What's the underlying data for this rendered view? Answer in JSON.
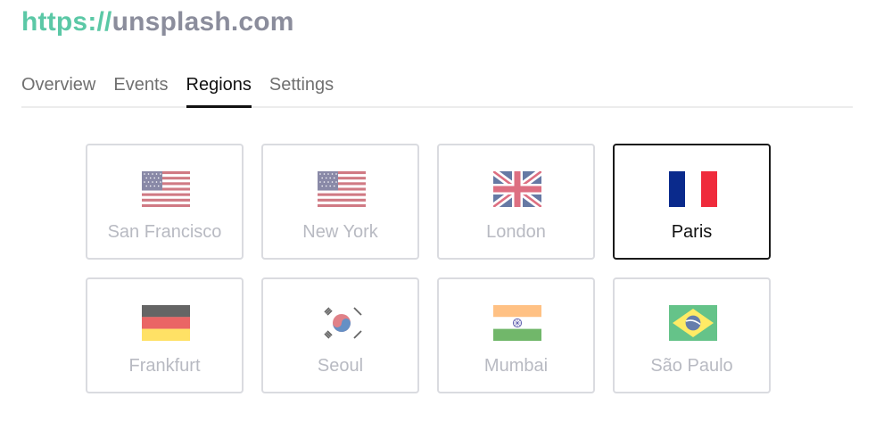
{
  "site": {
    "scheme": "https://",
    "host": "unsplash.com",
    "scheme_color": "#5bc8a6",
    "host_color": "#8b8d9c"
  },
  "tabs": [
    {
      "label": "Overview",
      "active": false
    },
    {
      "label": "Events",
      "active": false
    },
    {
      "label": "Regions",
      "active": true
    },
    {
      "label": "Settings",
      "active": false
    }
  ],
  "regions": [
    {
      "name": "San Francisco",
      "flag": "us-flag-icon",
      "selected": false
    },
    {
      "name": "New York",
      "flag": "us-flag-icon",
      "selected": false
    },
    {
      "name": "London",
      "flag": "uk-flag-icon",
      "selected": false
    },
    {
      "name": "Paris",
      "flag": "france-flag-icon",
      "selected": true
    },
    {
      "name": "Frankfurt",
      "flag": "germany-flag-icon",
      "selected": false
    },
    {
      "name": "Seoul",
      "flag": "south-korea-flag-icon",
      "selected": false
    },
    {
      "name": "Mumbai",
      "flag": "india-flag-icon",
      "selected": false
    },
    {
      "name": "São Paulo",
      "flag": "brazil-flag-icon",
      "selected": false
    }
  ]
}
